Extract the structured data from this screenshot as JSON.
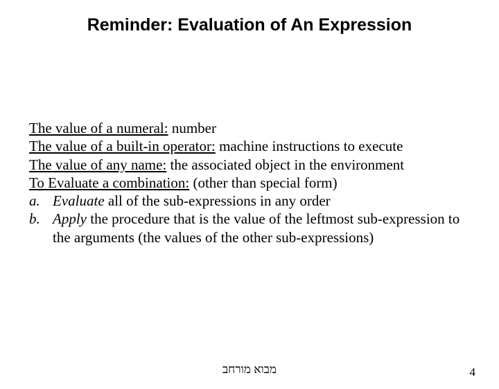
{
  "title": "Reminder: Evaluation of An Expression",
  "lines": {
    "numeral": {
      "label": "The value of a numeral:",
      "value": " number"
    },
    "operator": {
      "label": "The value of a built-in operator:",
      "value": " machine instructions to execute"
    },
    "name": {
      "label": "The value of any name:",
      "value": " the associated object in the environment"
    },
    "combo": {
      "label": "To Evaluate a combination:",
      "value": " (other than special form)"
    }
  },
  "steps": {
    "a": {
      "label": "a.",
      "em": "Evaluate",
      "rest": " all of the sub-expressions in any order"
    },
    "b": {
      "label": "b.",
      "em": "Apply",
      "rest": " the procedure that is the value of the leftmost sub-expression to the arguments (the values of the other sub-expressions)"
    }
  },
  "footer": {
    "center": "מבוא מורחב",
    "page": "4"
  }
}
